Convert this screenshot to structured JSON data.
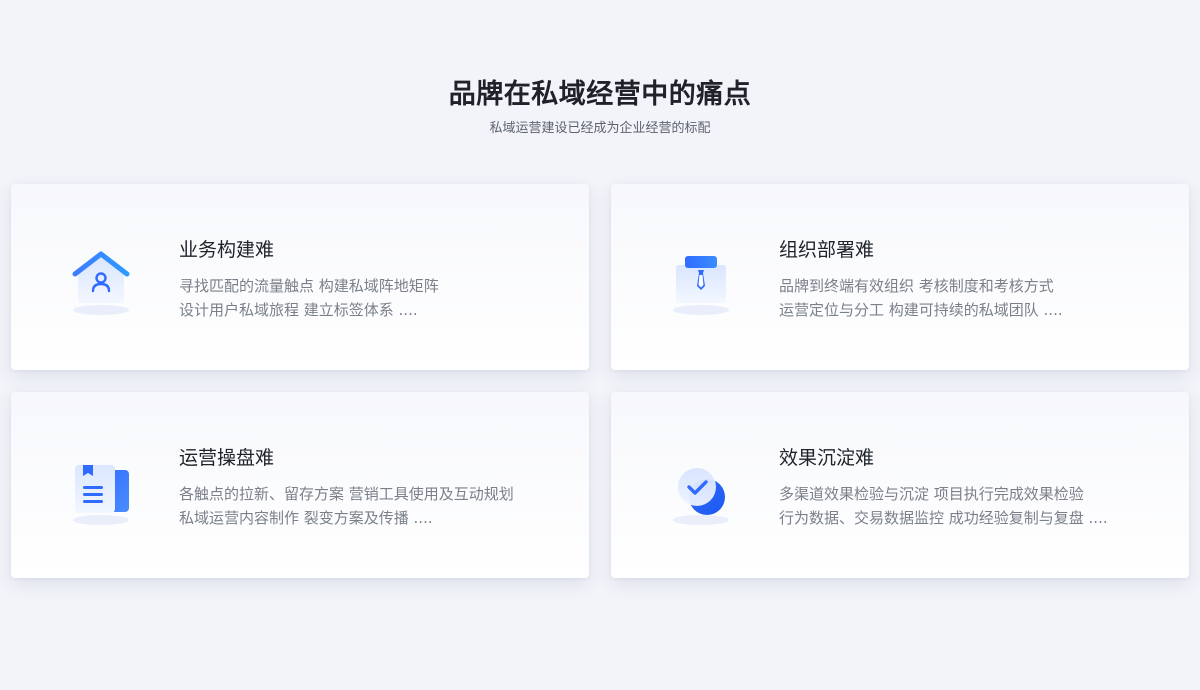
{
  "header": {
    "title": "品牌在私域经营中的痛点",
    "subtitle": "私域运营建设已经成为企业经营的标配"
  },
  "cards": [
    {
      "icon": "house-person-icon",
      "title": "业务构建难",
      "lines": [
        "寻找匹配的流量触点 构建私域阵地矩阵",
        "设计用户私域旅程 建立标签体系 ...."
      ]
    },
    {
      "icon": "briefcase-tie-icon",
      "title": "组织部署难",
      "lines": [
        "品牌到终端有效组织 考核制度和考核方式",
        "运营定位与分工 构建可持续的私域团队 ...."
      ]
    },
    {
      "icon": "document-list-icon",
      "title": "运营操盘难",
      "lines": [
        "各触点的拉新、留存方案 营销工具使用及互动规划",
        "私域运营内容制作 裂变方案及传播 ...."
      ]
    },
    {
      "icon": "check-circle-icon",
      "title": "效果沉淀难",
      "lines": [
        "多渠道效果检验与沉淀 项目执行完成效果检验",
        "行为数据、交易数据监控 成功经验复制与复盘 ...."
      ]
    }
  ],
  "colors": {
    "background": "#f2f4f9",
    "accent_blue": "#2f6bff",
    "title_text": "#1f2329",
    "body_text": "#7a7f89"
  }
}
